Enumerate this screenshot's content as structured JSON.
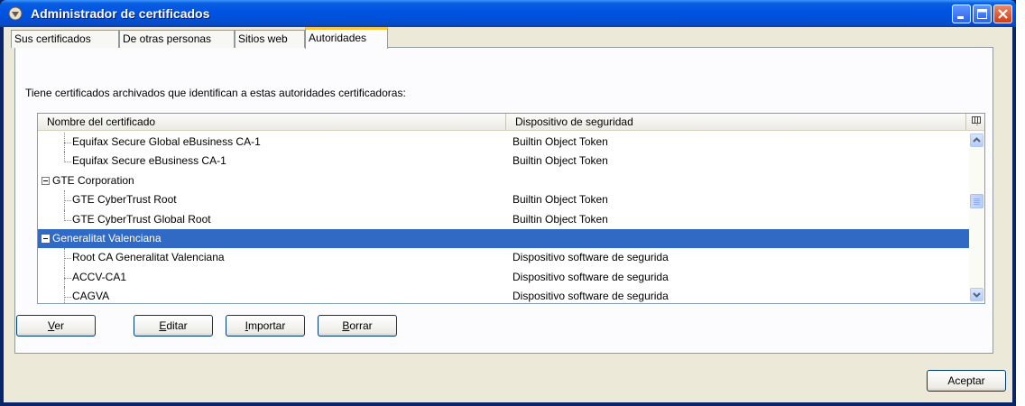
{
  "window": {
    "title": "Administrador de certificados",
    "controls": {
      "minimize_icon": "minimize-icon",
      "maximize_icon": "maximize-icon",
      "close_icon": "close-icon"
    }
  },
  "tabs": [
    {
      "label": "Sus certificados",
      "active": false
    },
    {
      "label": "De otras personas",
      "active": false
    },
    {
      "label": "Sitios web",
      "active": false
    },
    {
      "label": "Autoridades",
      "active": true
    }
  ],
  "panel": {
    "intro": "Tiene certificados archivados que identifican a estas autoridades certificadoras:"
  },
  "tree": {
    "columns": [
      "Nombre del certificado",
      "Dispositivo de seguridad"
    ],
    "rows": [
      {
        "level": 1,
        "name": "Equifax Secure Global eBusiness CA-1",
        "device": "Builtin Object Token"
      },
      {
        "level": 1,
        "name": "Equifax Secure eBusiness CA-1",
        "device": "Builtin Object Token"
      },
      {
        "level": 0,
        "name": "GTE Corporation",
        "device": ""
      },
      {
        "level": 1,
        "name": "GTE CyberTrust Root",
        "device": "Builtin Object Token"
      },
      {
        "level": 1,
        "name": "GTE CyberTrust Global Root",
        "device": "Builtin Object Token"
      },
      {
        "level": 0,
        "name": "Generalitat Valenciana",
        "device": "",
        "selected": true
      },
      {
        "level": 1,
        "name": "Root CA Generalitat Valenciana",
        "device": "Dispositivo software de segurida"
      },
      {
        "level": 1,
        "name": "ACCV-CA1",
        "device": "Dispositivo software de segurida"
      },
      {
        "level": 1,
        "name": "CAGVA",
        "device": "Dispositivo software de segurida"
      }
    ]
  },
  "buttons": {
    "ver": {
      "label": "Ver",
      "mnemonic": "V",
      "rest": "er"
    },
    "editar": {
      "label": "Editar",
      "mnemonic": "E",
      "rest": "ditar"
    },
    "importar": {
      "label": "Importar",
      "mnemonic": "I",
      "rest": "mportar"
    },
    "borrar": {
      "label": "Borrar",
      "mnemonic": "B",
      "rest": "orrar"
    },
    "aceptar": {
      "label": "Aceptar"
    }
  },
  "colors": {
    "selection": "#316ac5",
    "titlebar": "#0054e3",
    "dialog": "#ece9d8",
    "active_tab_accent": "#ffc83c"
  }
}
